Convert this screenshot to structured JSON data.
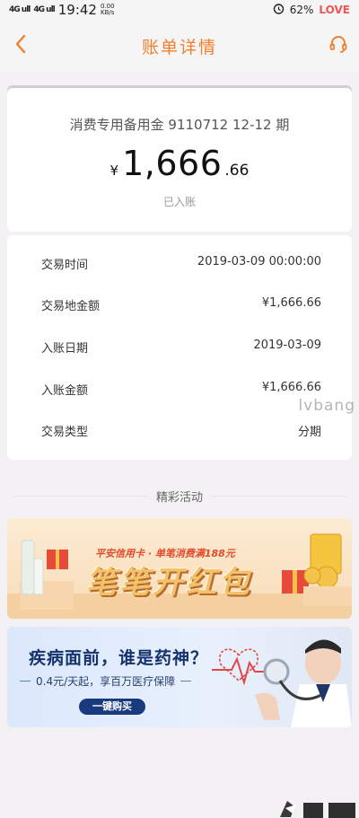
{
  "status_bar": {
    "signal1": "4G ull",
    "signal2": "4G ull",
    "time": "19:42",
    "speed_value": "0.00",
    "speed_unit": "KB/s",
    "battery_percent": "62%",
    "brand_text": "LOVE"
  },
  "header": {
    "title": "账单详情"
  },
  "summary": {
    "subtitle": "消费专用备用金 9110712 12-12 期",
    "currency_symbol": "¥",
    "amount_main": "1,666",
    "amount_decimal": ".66",
    "status": "已入账"
  },
  "details": [
    {
      "label": "交易时间",
      "value": "2019-03-09 00:00:00"
    },
    {
      "label": "交易地金额",
      "value": "¥1,666.66"
    },
    {
      "label": "入账日期",
      "value": "2019-03-09"
    },
    {
      "label": "入账金额",
      "value": "¥1,666.66"
    },
    {
      "label": "交易类型",
      "value": "分期"
    }
  ],
  "watermark": "lvbang",
  "promotions": {
    "section_title": "精彩活动",
    "banner1": {
      "subtitle": "平安信用卡 · 单笔消费满188元",
      "title": "笔笔开红包"
    },
    "banner2": {
      "title": "疾病面前，谁是药神？",
      "subtitle": "0.4元/天起，享百万医疗保障",
      "button": "一键购买"
    }
  },
  "colors": {
    "accent": "#f08030",
    "banner2_dark": "#16326e"
  },
  "icons": {
    "back": "chevron-left-icon",
    "service": "headset-icon",
    "alarm": "alarm-icon"
  }
}
